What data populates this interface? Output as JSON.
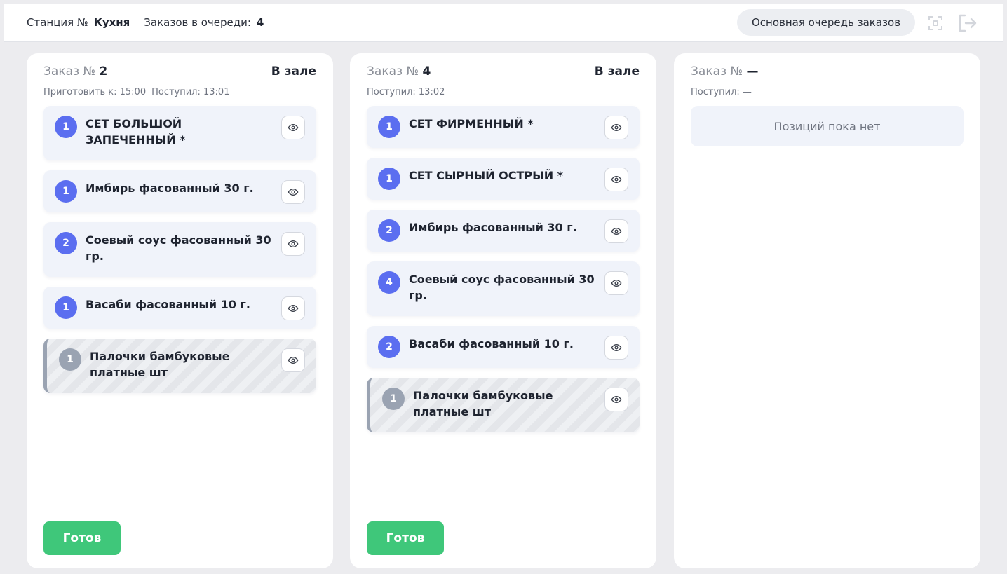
{
  "header": {
    "station_label": "Станция №",
    "station_value": "Кухня",
    "queue_label": "Заказов в очереди:",
    "queue_count": "4",
    "main_queue_button": "Основная очередь заказов"
  },
  "orders": [
    {
      "title_prefix": "Заказ №",
      "number": "2",
      "status": "В зале",
      "meta": [
        "Приготовить к: 15:00",
        "Поступил: 13:01"
      ],
      "items": [
        {
          "qty": "1",
          "name": "СЕТ БОЛЬШОЙ ЗАПЕЧЕННЫЙ *"
        },
        {
          "qty": "1",
          "name": "Имбирь фасованный 30 г."
        },
        {
          "qty": "2",
          "name": "Соевый соус фасованный 30 гр."
        },
        {
          "qty": "1",
          "name": "Васаби фасованный 10 г."
        },
        {
          "qty": "1",
          "name": "Палочки бамбуковые платные шт",
          "striped": true
        }
      ],
      "ready_label": "Готов"
    },
    {
      "title_prefix": "Заказ №",
      "number": "4",
      "status": "В зале",
      "meta": [
        "Поступил: 13:02"
      ],
      "items": [
        {
          "qty": "1",
          "name": "СЕТ ФИРМЕННЫЙ *"
        },
        {
          "qty": "1",
          "name": "СЕТ СЫРНЫЙ ОСТРЫЙ *"
        },
        {
          "qty": "2",
          "name": "Имбирь фасованный 30 г."
        },
        {
          "qty": "4",
          "name": "Соевый соус фасованный 30 гр."
        },
        {
          "qty": "2",
          "name": "Васаби фасованный 10 г."
        },
        {
          "qty": "1",
          "name": "Палочки бамбуковые платные шт",
          "striped": true
        }
      ],
      "ready_label": "Готов"
    },
    {
      "title_prefix": "Заказ №",
      "number": "—",
      "status": "",
      "meta": [
        "Поступил: —"
      ],
      "empty_text": "Позиций пока нет"
    }
  ],
  "icons": {
    "eye": "eye-icon",
    "fullscreen": "fullscreen-icon",
    "logout": "logout-icon"
  },
  "colors": {
    "accent": "#5b6ef0",
    "ready": "#3fc77a",
    "disabled_item": "#9aa3b2"
  }
}
